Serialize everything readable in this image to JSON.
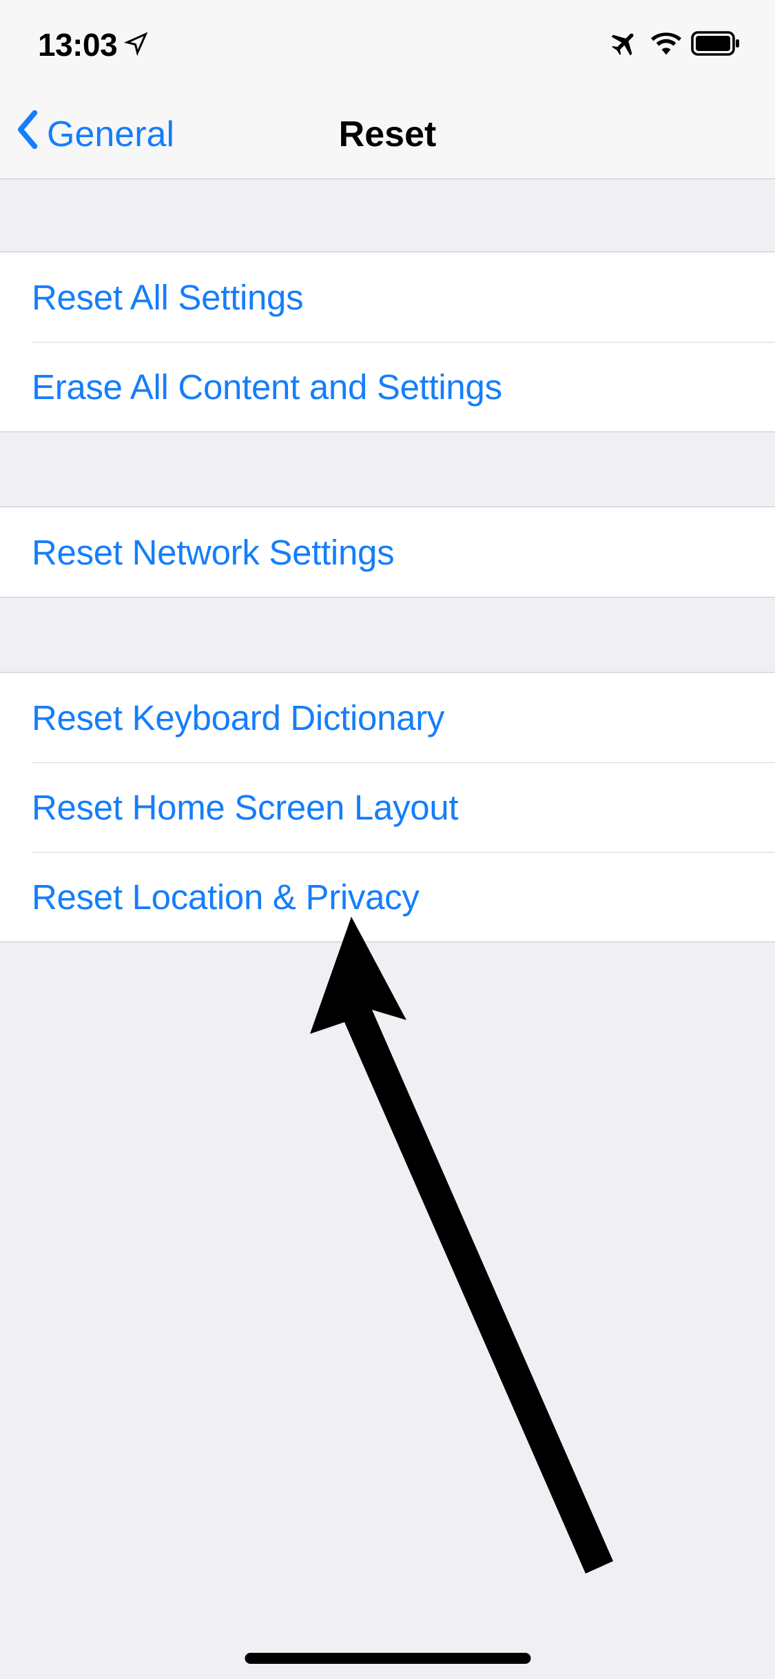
{
  "statusBar": {
    "time": "13:03"
  },
  "nav": {
    "backLabel": "General",
    "title": "Reset"
  },
  "groups": [
    {
      "items": [
        {
          "label": "Reset All Settings"
        },
        {
          "label": "Erase All Content and Settings"
        }
      ]
    },
    {
      "items": [
        {
          "label": "Reset Network Settings"
        }
      ]
    },
    {
      "items": [
        {
          "label": "Reset Keyboard Dictionary"
        },
        {
          "label": "Reset Home Screen Layout"
        },
        {
          "label": "Reset Location & Privacy"
        }
      ]
    }
  ]
}
